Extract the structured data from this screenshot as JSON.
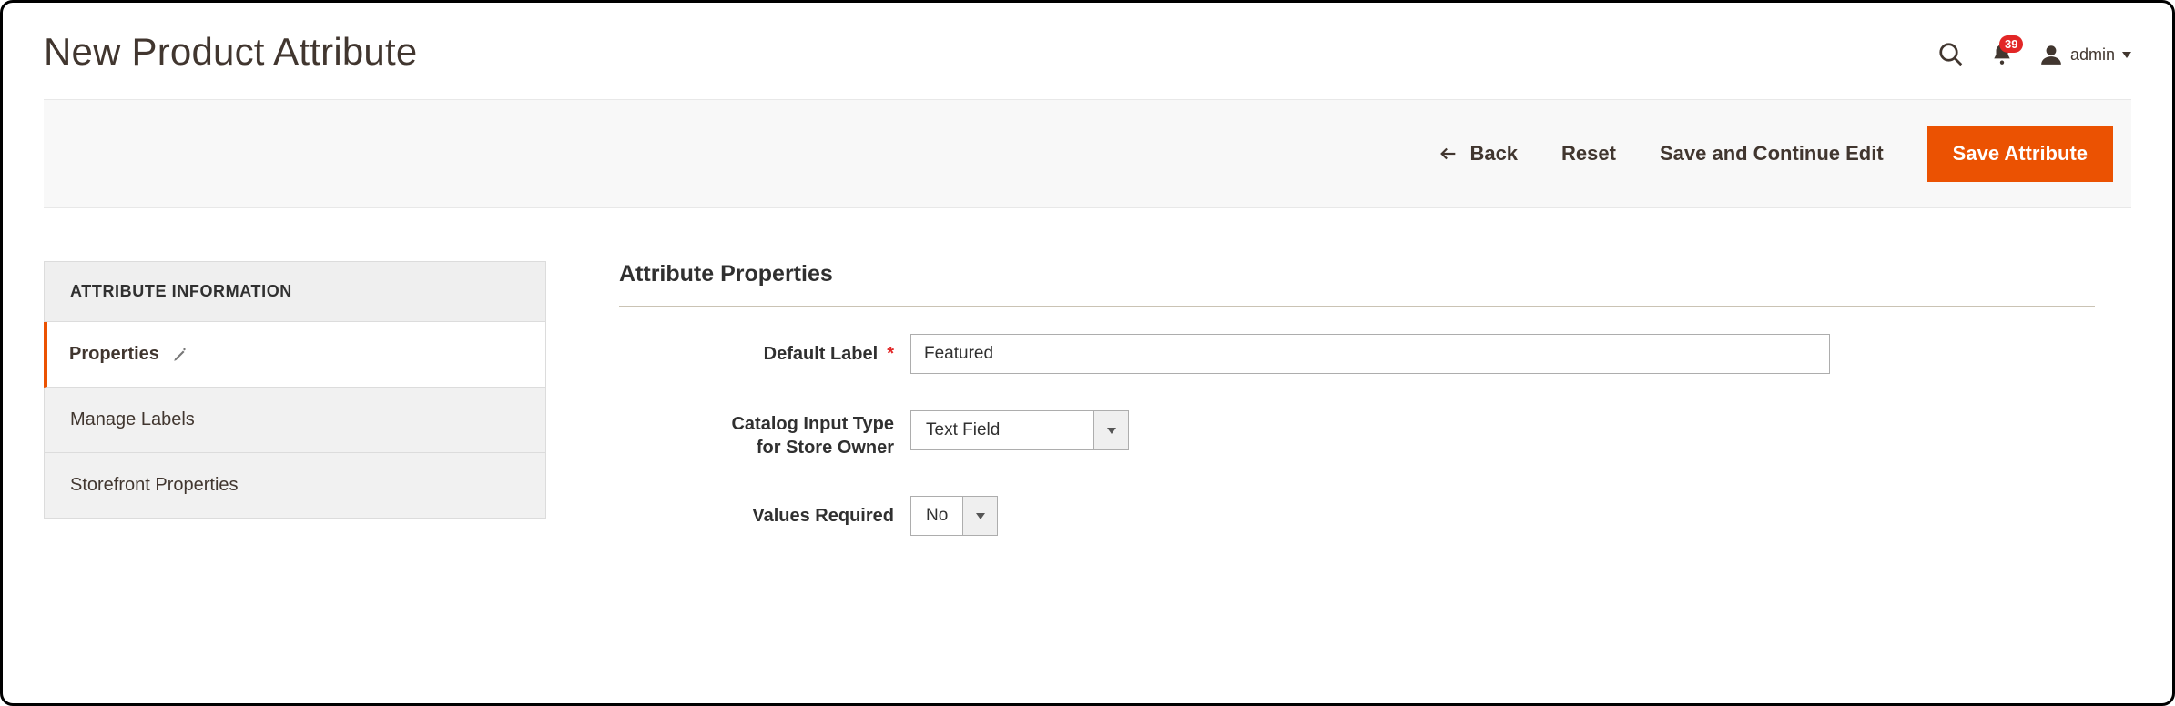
{
  "header": {
    "title": "New Product Attribute",
    "notification_count": "39",
    "user_name": "admin"
  },
  "actions": {
    "back": "Back",
    "reset": "Reset",
    "save_continue": "Save and Continue Edit",
    "save": "Save Attribute"
  },
  "sidebar": {
    "heading": "ATTRIBUTE INFORMATION",
    "items": [
      {
        "label": "Properties"
      },
      {
        "label": "Manage Labels"
      },
      {
        "label": "Storefront Properties"
      }
    ]
  },
  "main": {
    "section_title": "Attribute Properties",
    "fields": {
      "default_label": {
        "label": "Default Label",
        "value": "Featured"
      },
      "input_type": {
        "label": "Catalog Input Type for Store Owner",
        "value": "Text Field"
      },
      "values_required": {
        "label": "Values Required",
        "value": "No"
      }
    }
  }
}
